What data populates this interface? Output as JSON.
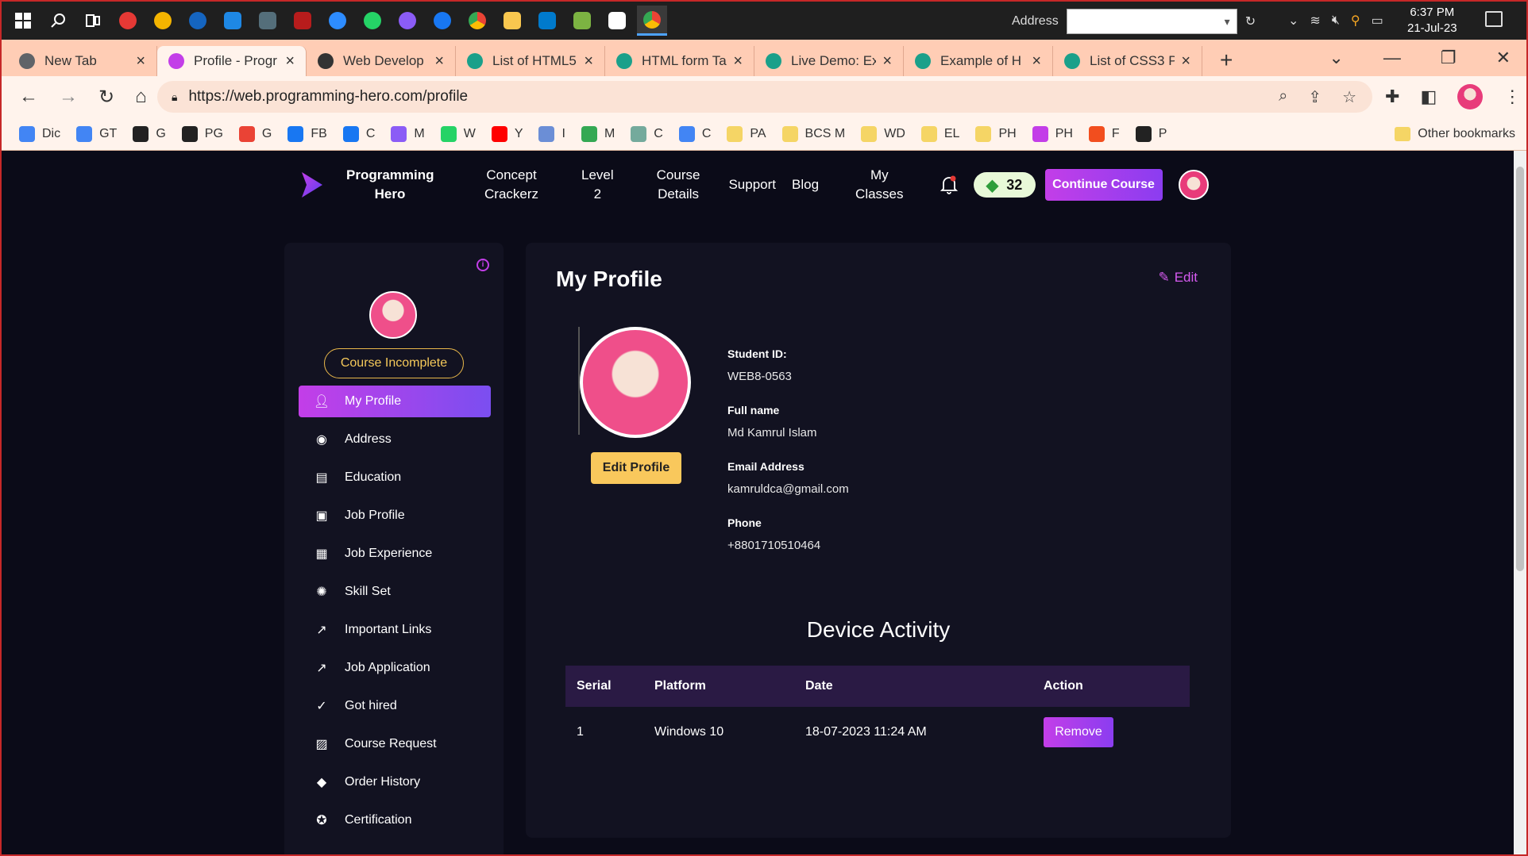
{
  "taskbar": {
    "address_label": "Address",
    "time": "6:37 PM",
    "date": "21-Jul-23"
  },
  "browser": {
    "tabs": [
      {
        "title": "New Tab",
        "color": "#5f6368"
      },
      {
        "title": "Profile - Progr",
        "color": "#c33ee8"
      },
      {
        "title": "Web Develop",
        "color": "#333333"
      },
      {
        "title": "List of HTML5",
        "color": "#1aa08a"
      },
      {
        "title": "HTML form Ta",
        "color": "#1aa08a"
      },
      {
        "title": "Live Demo: Ex",
        "color": "#1aa08a"
      },
      {
        "title": "Example of H",
        "color": "#1aa08a"
      },
      {
        "title": "List of CSS3 P",
        "color": "#1aa08a"
      }
    ],
    "url": "https://web.programming-hero.com/profile",
    "bookmarks": [
      {
        "label": "Dic",
        "color": "#4285f4"
      },
      {
        "label": "GT",
        "color": "#4285f4"
      },
      {
        "label": "G",
        "color": "#222222"
      },
      {
        "label": "PG",
        "color": "#222222"
      },
      {
        "label": "G",
        "color": "#ea4335"
      },
      {
        "label": "FB",
        "color": "#1877f2"
      },
      {
        "label": "C",
        "color": "#1877f2"
      },
      {
        "label": "M",
        "color": "#8b5cf6"
      },
      {
        "label": "W",
        "color": "#25d366"
      },
      {
        "label": "Y",
        "color": "#ff0000"
      },
      {
        "label": "I",
        "color": "#6b8ed6"
      },
      {
        "label": "M",
        "color": "#34a853"
      },
      {
        "label": "C",
        "color": "#74aa9c"
      },
      {
        "label": "C",
        "color": "#4285f4"
      },
      {
        "label": "PA",
        "color": "#f5d565"
      },
      {
        "label": "BCS M",
        "color": "#f5d565"
      },
      {
        "label": "WD",
        "color": "#f5d565"
      },
      {
        "label": "EL",
        "color": "#f5d565"
      },
      {
        "label": "PH",
        "color": "#f5d565"
      },
      {
        "label": "PH",
        "color": "#c33ee8"
      },
      {
        "label": "F",
        "color": "#f24e1e"
      },
      {
        "label": "P",
        "color": "#222222"
      }
    ],
    "other_bookmarks": "Other bookmarks"
  },
  "site_nav": {
    "brand_line1": "Programming",
    "brand_line2": "Hero",
    "links": [
      {
        "l1": "Concept",
        "l2": "Crackerz"
      },
      {
        "l1": "Level",
        "l2": "2"
      },
      {
        "l1": "Course",
        "l2": "Details"
      },
      {
        "l1": "Support",
        "l2": ""
      },
      {
        "l1": "Blog",
        "l2": ""
      },
      {
        "l1": "My",
        "l2": "Classes"
      }
    ],
    "gems": "32",
    "cta": "Continue Course"
  },
  "sidebar": {
    "status_badge": "Course Incomplete",
    "items": [
      {
        "label": "My Profile",
        "icon": "user-icon"
      },
      {
        "label": "Address",
        "icon": "location-icon"
      },
      {
        "label": "Education",
        "icon": "book-icon"
      },
      {
        "label": "Job Profile",
        "icon": "briefcase-icon"
      },
      {
        "label": "Job Experience",
        "icon": "document-icon"
      },
      {
        "label": "Skill Set",
        "icon": "bulb-icon"
      },
      {
        "label": "Important Links",
        "icon": "external-link-icon"
      },
      {
        "label": "Job Application",
        "icon": "external-link-icon"
      },
      {
        "label": "Got hired",
        "icon": "user-check-icon"
      },
      {
        "label": "Course Request",
        "icon": "image-icon"
      },
      {
        "label": "Order History",
        "icon": "tag-icon"
      },
      {
        "label": "Certification",
        "icon": "award-icon"
      }
    ]
  },
  "profile": {
    "title": "My Profile",
    "edit_label": "Edit",
    "edit_profile_button": "Edit Profile",
    "fields": [
      {
        "label": "Student ID:",
        "value": "WEB8-0563"
      },
      {
        "label": "Full name",
        "value": "Md Kamrul Islam"
      },
      {
        "label": "Email Address",
        "value": "kamruldca@gmail.com"
      },
      {
        "label": "Phone",
        "value": "+8801710510464"
      }
    ]
  },
  "device_activity": {
    "title": "Device Activity",
    "headers": [
      "Serial",
      "Platform",
      "Date",
      "Action"
    ],
    "rows": [
      {
        "serial": "1",
        "platform": "Windows 10",
        "date": "18-07-2023 11:24 AM",
        "action": "Remove"
      }
    ]
  }
}
